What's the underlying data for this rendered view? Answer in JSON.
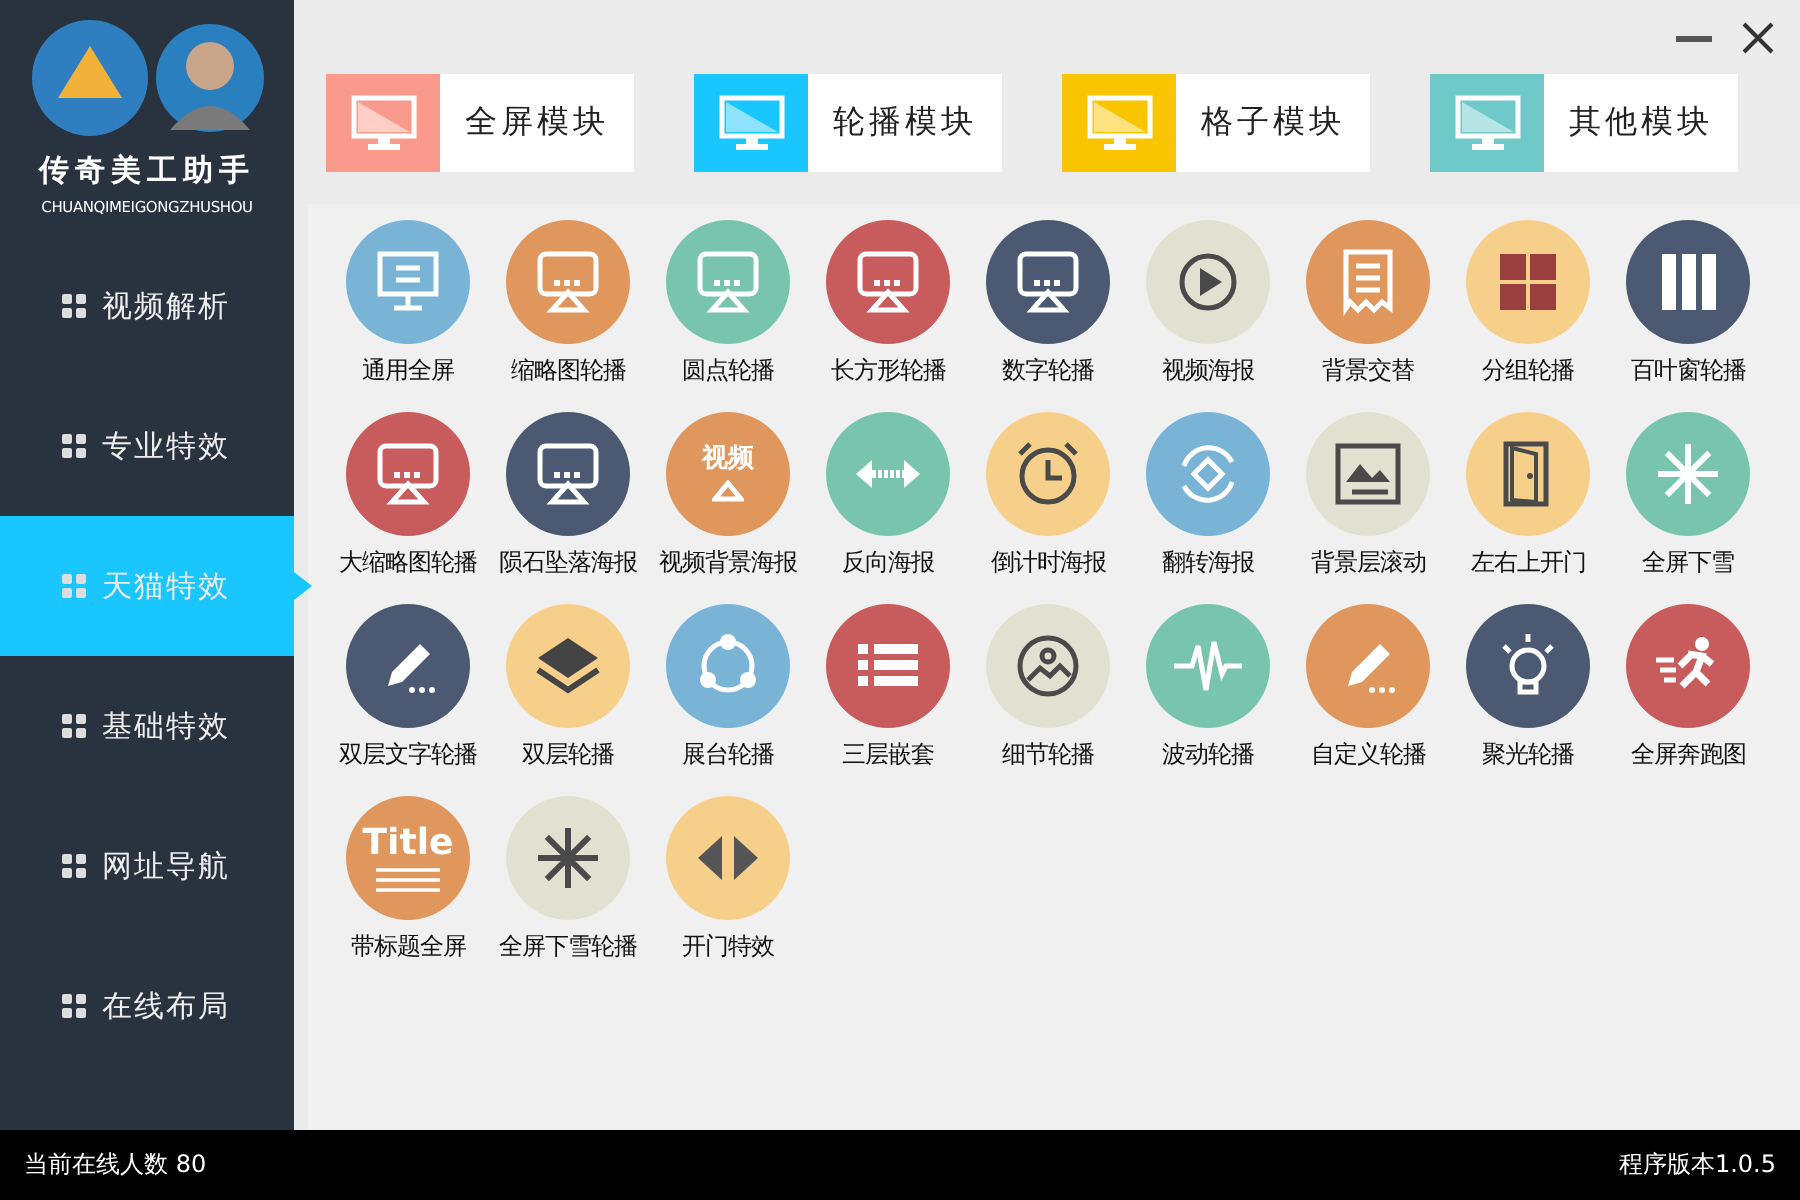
{
  "app": {
    "title": "传奇美工助手",
    "subtitle": "CHUANQIMEIGONGZHUSHOU"
  },
  "tabs": [
    {
      "label": "全屏模块",
      "color": "#fa9a8c"
    },
    {
      "label": "轮播模块",
      "color": "#1ac6ff"
    },
    {
      "label": "格子模块",
      "color": "#f9c400"
    },
    {
      "label": "其他模块",
      "color": "#6ec9c8"
    }
  ],
  "sidebar": {
    "items": [
      {
        "label": "视频解析",
        "selected": false
      },
      {
        "label": "专业特效",
        "selected": false
      },
      {
        "label": "天猫特效",
        "selected": true
      },
      {
        "label": "基础特效",
        "selected": false
      },
      {
        "label": "网址导航",
        "selected": false
      },
      {
        "label": "在线布局",
        "selected": false
      }
    ]
  },
  "tiles": [
    {
      "label": "通用全屏",
      "color": "#79b3d6"
    },
    {
      "label": "缩略图轮播",
      "color": "#e0975e"
    },
    {
      "label": "圆点轮播",
      "color": "#79c4ad"
    },
    {
      "label": "长方形轮播",
      "color": "#c85b5b"
    },
    {
      "label": "数字轮播",
      "color": "#4b5a72"
    },
    {
      "label": "视频海报",
      "color": "#e1e1d1"
    },
    {
      "label": "背景交替",
      "color": "#e0975e"
    },
    {
      "label": "分组轮播",
      "color": "#f6d08b"
    },
    {
      "label": "百叶窗轮播",
      "color": "#4b5a72"
    },
    {
      "label": "大缩略图轮播",
      "color": "#c85b5b"
    },
    {
      "label": "陨石坠落海报",
      "color": "#4b5a72"
    },
    {
      "label": "视频背景海报",
      "color": "#e0975e",
      "icon_text": "视频"
    },
    {
      "label": "反向海报",
      "color": "#79c4ad"
    },
    {
      "label": "倒计时海报",
      "color": "#f6d08b"
    },
    {
      "label": "翻转海报",
      "color": "#79b3d6"
    },
    {
      "label": "背景层滚动",
      "color": "#e1e1d1"
    },
    {
      "label": "左右上开门",
      "color": "#f6d08b"
    },
    {
      "label": "全屏下雪",
      "color": "#79c4ad"
    },
    {
      "label": "双层文字轮播",
      "color": "#4b5a72"
    },
    {
      "label": "双层轮播",
      "color": "#f6d08b"
    },
    {
      "label": "展台轮播",
      "color": "#79b3d6"
    },
    {
      "label": "三层嵌套",
      "color": "#c85b5b"
    },
    {
      "label": "细节轮播",
      "color": "#e1e1d1"
    },
    {
      "label": "波动轮播",
      "color": "#79c4ad"
    },
    {
      "label": "自定义轮播",
      "color": "#e0975e"
    },
    {
      "label": "聚光轮播",
      "color": "#4b5a72"
    },
    {
      "label": "全屏奔跑图",
      "color": "#c85b5b"
    },
    {
      "label": "带标题全屏",
      "color": "#e0975e",
      "icon_text": "Title"
    },
    {
      "label": "全屏下雪轮播",
      "color": "#e1e1d1"
    },
    {
      "label": "开门特效",
      "color": "#f6d08b"
    }
  ],
  "status_bar": {
    "online": "当前在线人数 80",
    "version": "程序版本1.0.5"
  }
}
